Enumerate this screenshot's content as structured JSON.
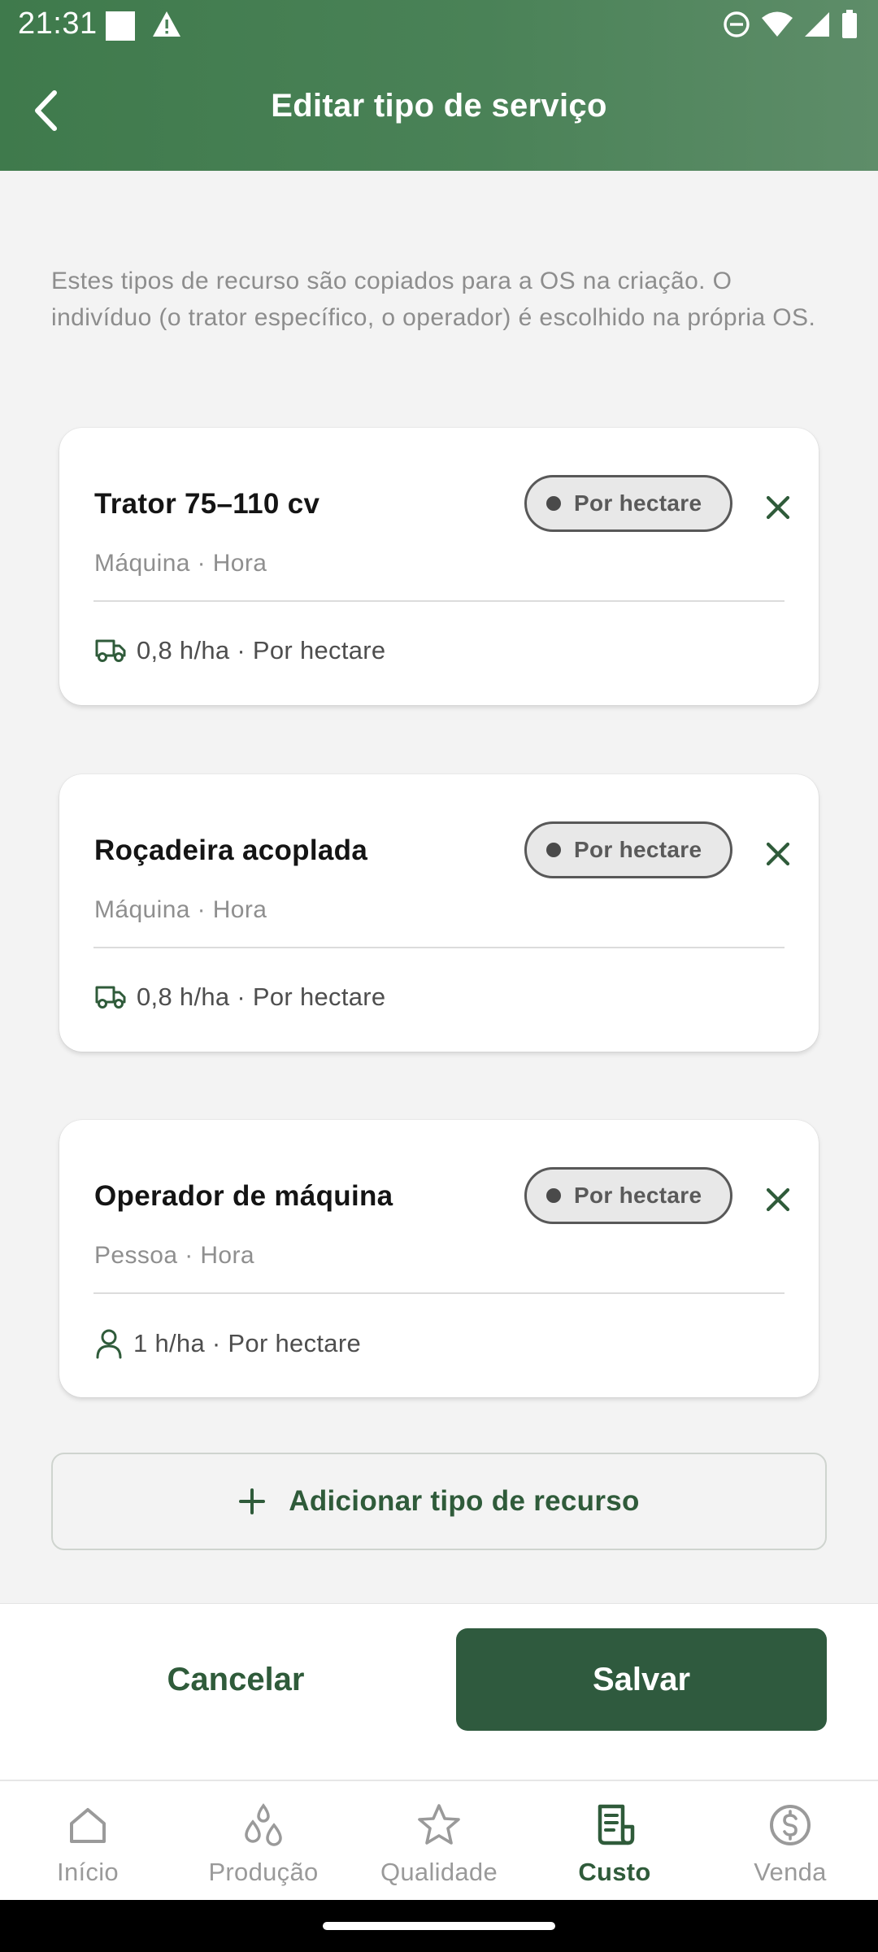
{
  "status_bar": {
    "time": "21:31"
  },
  "header": {
    "title": "Editar tipo de serviço"
  },
  "hint": "Estes tipos de recurso são copiados para a OS na criação. O indivíduo (o trator específico, o operador) é escolhido na própria OS.",
  "resources": [
    {
      "name": "Trator 75–110 cv",
      "chip": "Por hectare",
      "subtitle": "Máquina · Hora",
      "detail": "0,8 h/ha · Por hectare",
      "icon": "truck-icon"
    },
    {
      "name": "Roçadeira acoplada",
      "chip": "Por hectare",
      "subtitle": "Máquina · Hora",
      "detail": "0,8 h/ha · Por hectare",
      "icon": "truck-icon"
    },
    {
      "name": "Operador de máquina",
      "chip": "Por hectare",
      "subtitle": "Pessoa · Hora",
      "detail": "1 h/ha · Por hectare",
      "icon": "person-icon"
    }
  ],
  "add_button": "Adicionar tipo de recurso",
  "footer": {
    "cancel": "Cancelar",
    "save": "Salvar"
  },
  "nav": [
    {
      "label": "Início",
      "icon": "home-icon",
      "active": false
    },
    {
      "label": "Produção",
      "icon": "drops-icon",
      "active": false
    },
    {
      "label": "Qualidade",
      "icon": "star-icon",
      "active": false
    },
    {
      "label": "Custo",
      "icon": "receipt-icon",
      "active": true
    },
    {
      "label": "Venda",
      "icon": "dollar-circle-icon",
      "active": false
    }
  ],
  "colors": {
    "header": "#4a8257",
    "primary_dark": "#2f5a3e",
    "accent_text": "#2f5b3a"
  }
}
